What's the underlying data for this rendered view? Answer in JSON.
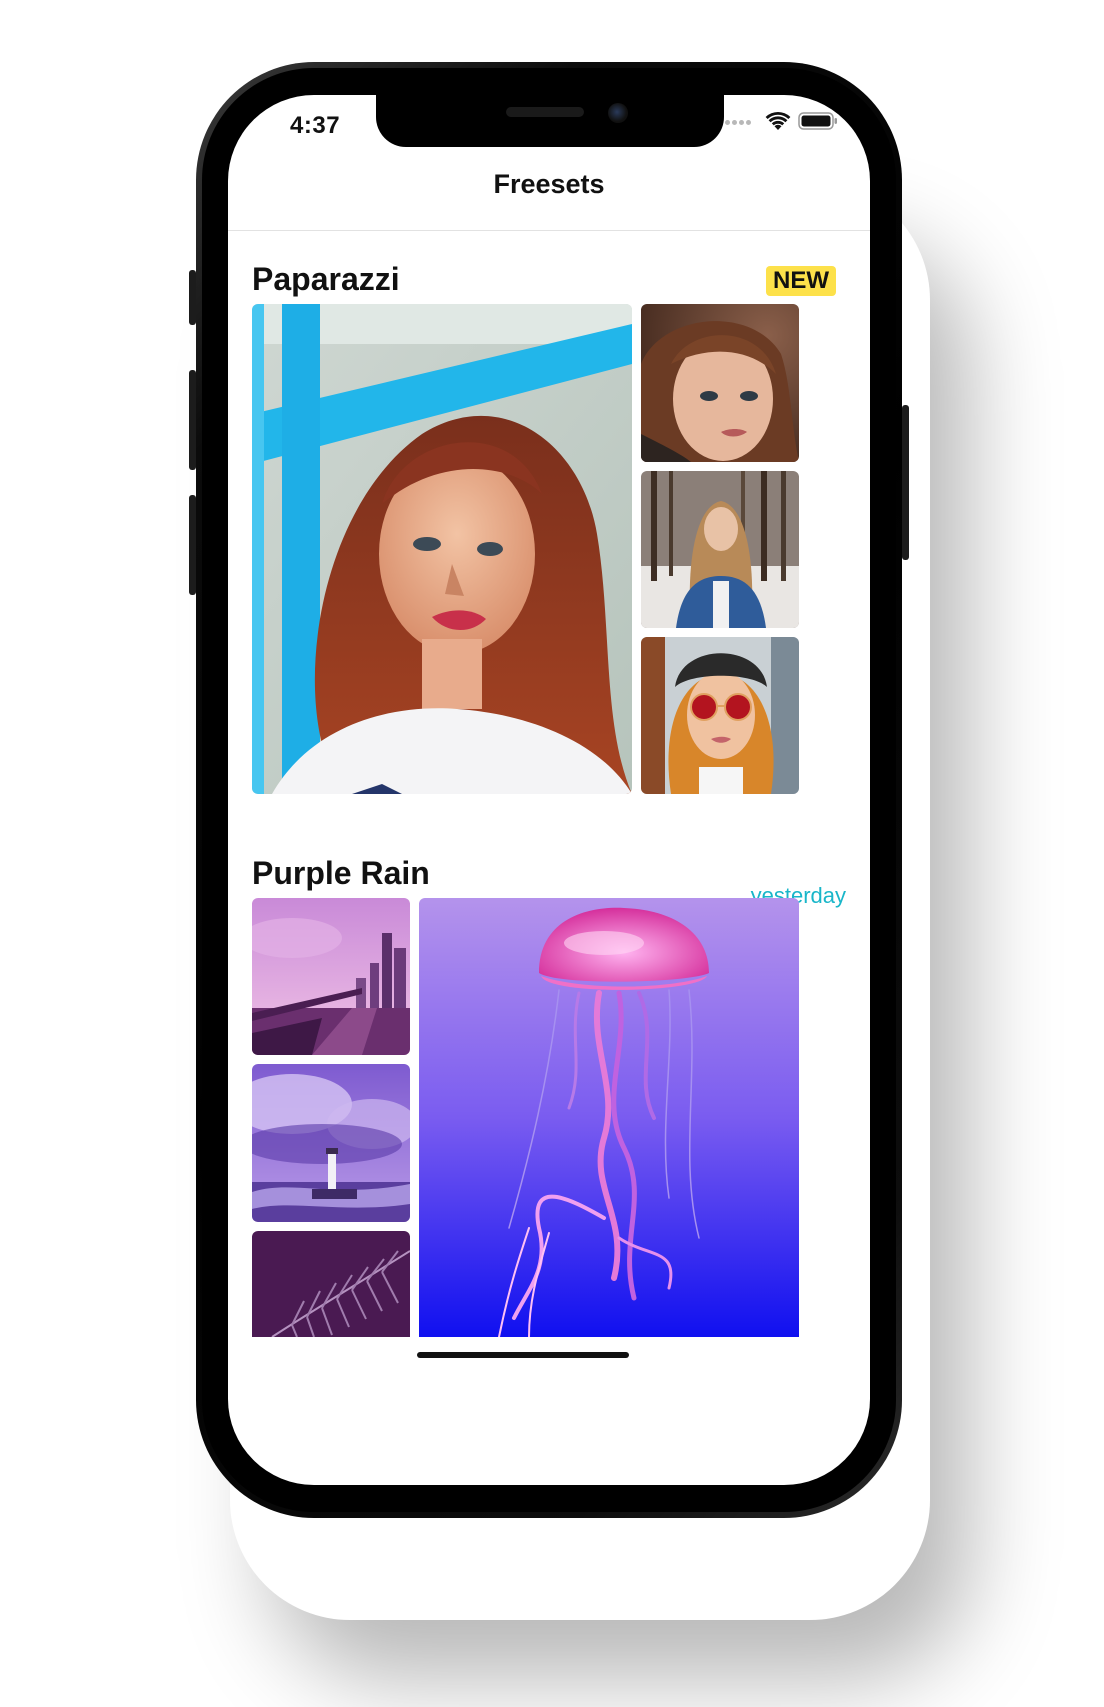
{
  "status_bar": {
    "time": "4:37"
  },
  "nav": {
    "title": "Freesets"
  },
  "sections": [
    {
      "title": "Paparazzi",
      "badge": "NEW",
      "badge_color": "#fde14a",
      "photos": [
        "portrait-red-hair-blue-window",
        "portrait-close-up-brown-hair",
        "portrait-winter-forest-denim",
        "portrait-sunglasses-beanie"
      ]
    },
    {
      "title": "Purple Rain",
      "badge": "yesterday",
      "badge_color": "#19b6c9",
      "photos": [
        "purple-city-bridge",
        "purple-lighthouse-clouds",
        "purple-fern-leaf",
        "purple-jellyfish"
      ]
    }
  ],
  "icons": [
    "wifi-icon",
    "battery-icon"
  ]
}
